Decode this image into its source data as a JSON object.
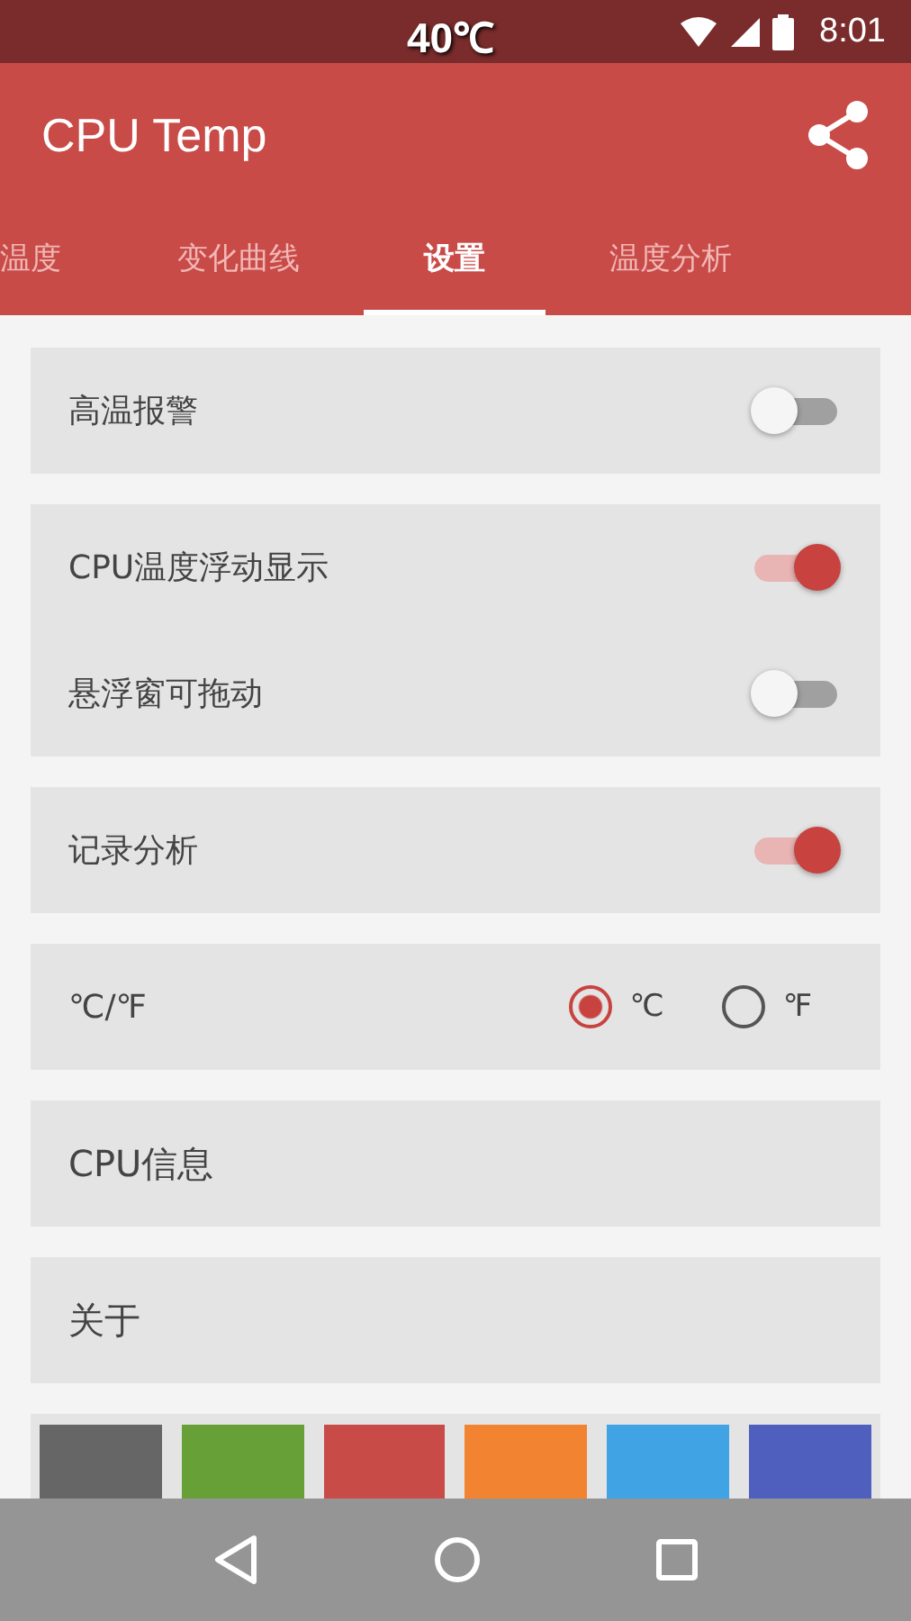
{
  "status_bar": {
    "temperature": "40℃",
    "time": "8:01"
  },
  "toolbar": {
    "title": "CPU Temp"
  },
  "tabs": [
    {
      "label": "温度",
      "selected": false
    },
    {
      "label": "变化曲线",
      "selected": false
    },
    {
      "label": "设置",
      "selected": true
    },
    {
      "label": "温度分析",
      "selected": false
    }
  ],
  "settings": [
    {
      "items": [
        {
          "kind": "switch",
          "label": "高温报警",
          "on": false
        }
      ]
    },
    {
      "items": [
        {
          "kind": "switch",
          "label": "CPU温度浮动显示",
          "on": true
        },
        {
          "kind": "switch",
          "label": "悬浮窗可拖动",
          "on": false
        }
      ]
    },
    {
      "items": [
        {
          "kind": "switch",
          "label": "记录分析",
          "on": true
        }
      ]
    },
    {
      "items": [
        {
          "kind": "radio",
          "label": "℃/℉",
          "options": [
            {
              "label": "℃",
              "selected": true
            },
            {
              "label": "℉",
              "selected": false
            }
          ]
        }
      ]
    },
    {
      "items": [
        {
          "kind": "link",
          "label": "CPU信息"
        }
      ]
    },
    {
      "items": [
        {
          "kind": "link",
          "label": "关于"
        }
      ]
    }
  ],
  "theme_colors": [
    {
      "color": "#666666"
    },
    {
      "color": "#68a038"
    },
    {
      "color": "#c84b48"
    },
    {
      "color": "#f28431"
    },
    {
      "color": "#3fa3e4"
    },
    {
      "color": "#4f5fbd"
    }
  ]
}
